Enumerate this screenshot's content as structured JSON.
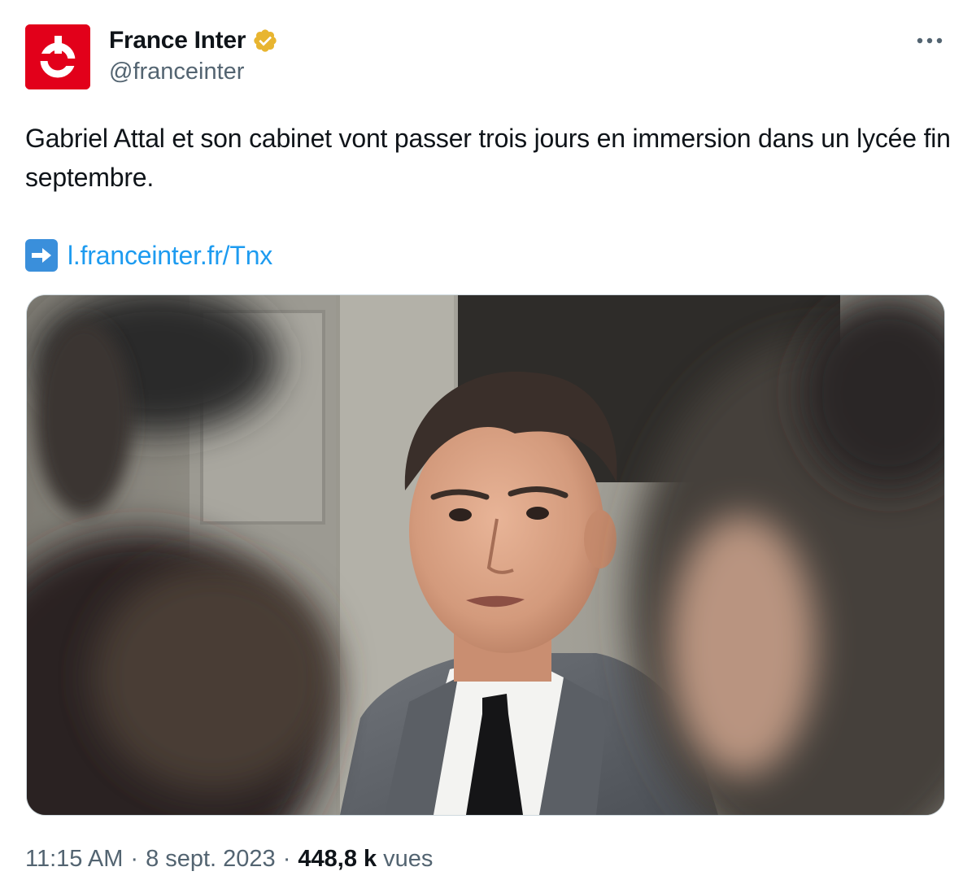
{
  "author": {
    "name": "France Inter",
    "handle": "@franceinter",
    "verified": true,
    "avatar_icon": "france-inter-logo",
    "avatar_color": "#e2001a",
    "badge_color": "#e8b530"
  },
  "menu": {
    "icon": "more-horizontal-icon"
  },
  "tweet": {
    "text": "Gabriel Attal et son cabinet vont passer trois jours en immersion dans un lycée fin septembre.",
    "link_icon": "right-arrow-emoji",
    "link_text": "l.franceinter.fr/Tnx"
  },
  "media": {
    "type": "photo",
    "icon": "photo"
  },
  "meta": {
    "time": "11:15 AM",
    "separator": "·",
    "date": "8 sept. 2023",
    "views_count": "448,8 k",
    "views_label": "vues"
  },
  "colors": {
    "text": "#0f1419",
    "secondary": "#536471",
    "link": "#1d9bf0",
    "border": "#cfd9de"
  }
}
